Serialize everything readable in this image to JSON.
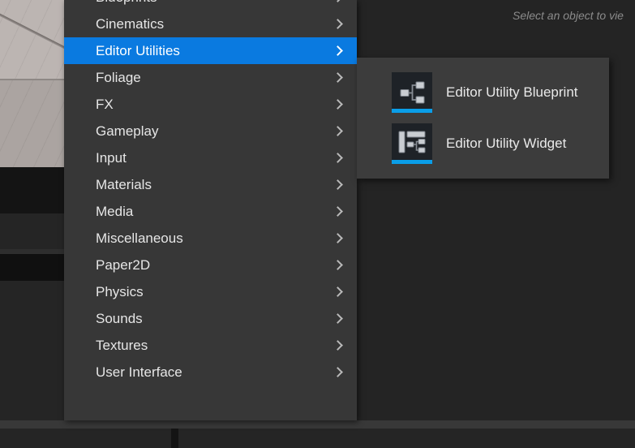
{
  "app": {
    "background_color": "#242424",
    "menu_background": "#373737",
    "submenu_background": "#3c3c3c",
    "highlight_color": "#0a7ae0",
    "asset_accent_color": "#0a9ee8",
    "text_color": "#e6e6e6"
  },
  "details_panel": {
    "hint_text": "Select an object to vie"
  },
  "context_menu": {
    "name": "create-advanced-asset-menu",
    "items": [
      {
        "label": "Blueprints",
        "has_submenu": true,
        "selected": false
      },
      {
        "label": "Cinematics",
        "has_submenu": true,
        "selected": false
      },
      {
        "label": "Editor Utilities",
        "has_submenu": true,
        "selected": true
      },
      {
        "label": "Foliage",
        "has_submenu": true,
        "selected": false
      },
      {
        "label": "FX",
        "has_submenu": true,
        "selected": false
      },
      {
        "label": "Gameplay",
        "has_submenu": true,
        "selected": false
      },
      {
        "label": "Input",
        "has_submenu": true,
        "selected": false
      },
      {
        "label": "Materials",
        "has_submenu": true,
        "selected": false
      },
      {
        "label": "Media",
        "has_submenu": true,
        "selected": false
      },
      {
        "label": "Miscellaneous",
        "has_submenu": true,
        "selected": false
      },
      {
        "label": "Paper2D",
        "has_submenu": true,
        "selected": false
      },
      {
        "label": "Physics",
        "has_submenu": true,
        "selected": false
      },
      {
        "label": "Sounds",
        "has_submenu": true,
        "selected": false
      },
      {
        "label": "Textures",
        "has_submenu": true,
        "selected": false
      },
      {
        "label": "User Interface",
        "has_submenu": true,
        "selected": false
      }
    ]
  },
  "submenu": {
    "name": "editor-utilities-submenu",
    "parent": "Editor Utilities",
    "items": [
      {
        "label": "Editor Utility Blueprint",
        "icon": "editor-utility-blueprint-icon"
      },
      {
        "label": "Editor Utility Widget",
        "icon": "editor-utility-widget-icon"
      }
    ]
  }
}
